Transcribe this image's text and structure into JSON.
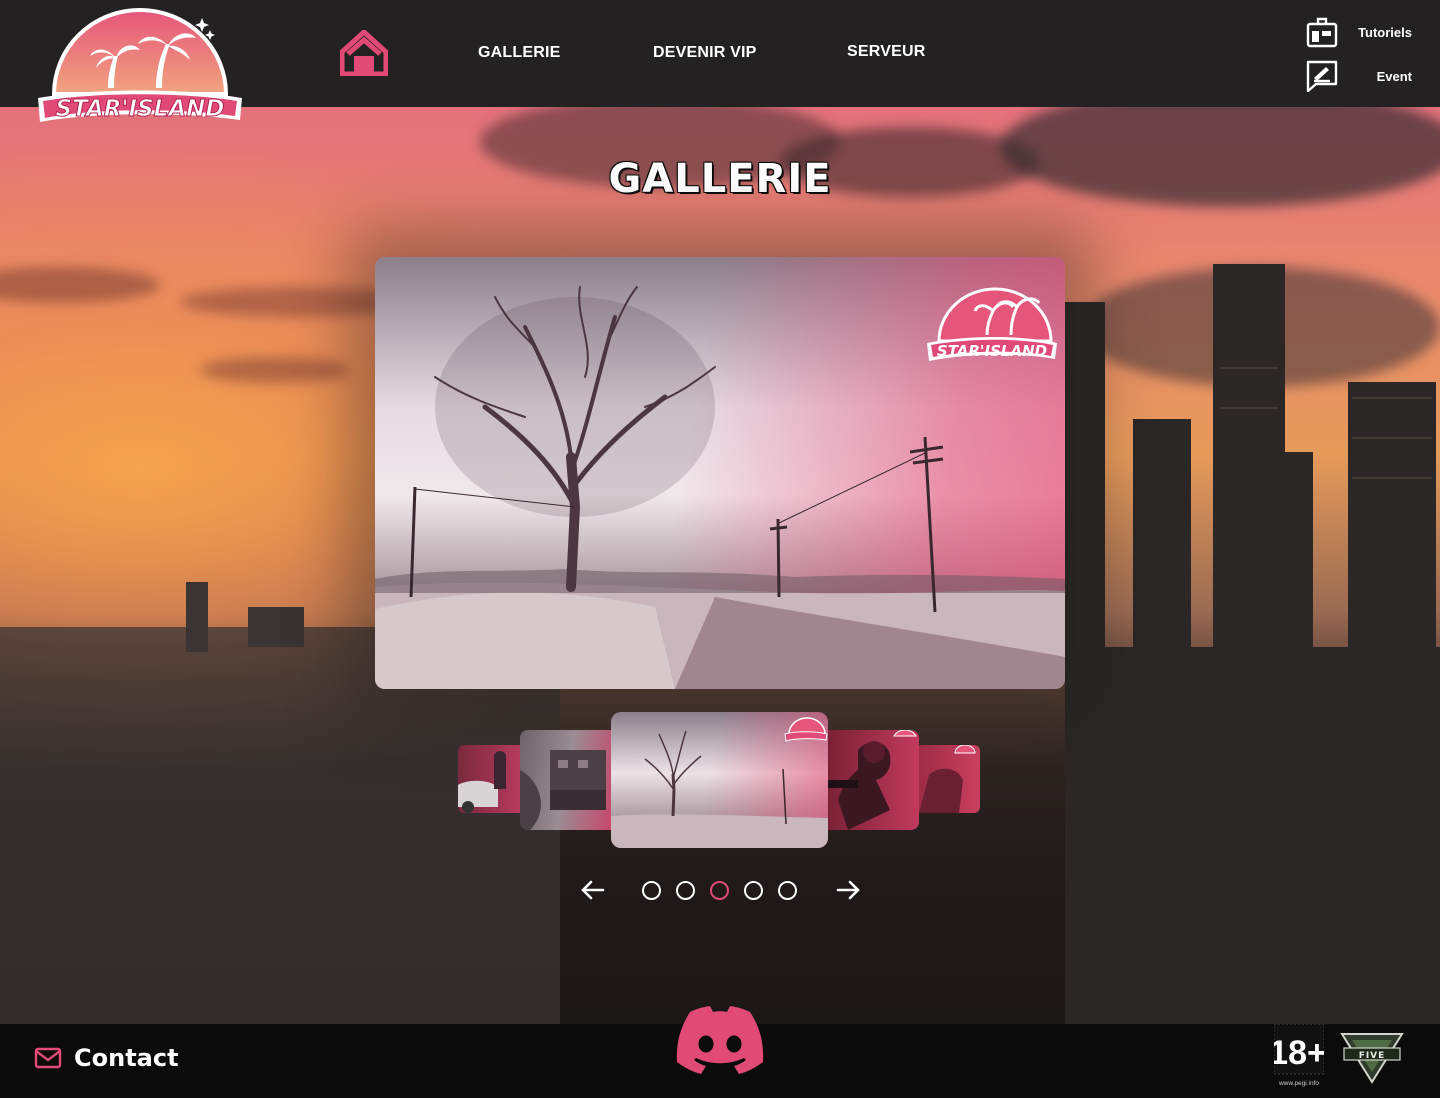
{
  "brand": {
    "logo_text": "STAR'ISLAND"
  },
  "nav": {
    "home_label": "home",
    "links": [
      "GALLERIE",
      "DEVENIR VIP",
      "SERVEUR"
    ]
  },
  "side_links": {
    "tutorials": "Tutoriels",
    "event": "Event"
  },
  "gallery": {
    "title": "GALLERIE",
    "watermark": "STAR'ISLAND",
    "dots_count": 5,
    "active_index": 2
  },
  "footer": {
    "contact": "Contact",
    "pegi_rating": "18+",
    "pegi_url": "www.pegi.info",
    "game_logo": "FIVE"
  },
  "colors": {
    "accent": "#e14a76",
    "header_bg": "#242122",
    "footer_bg": "#0b0b0c"
  }
}
